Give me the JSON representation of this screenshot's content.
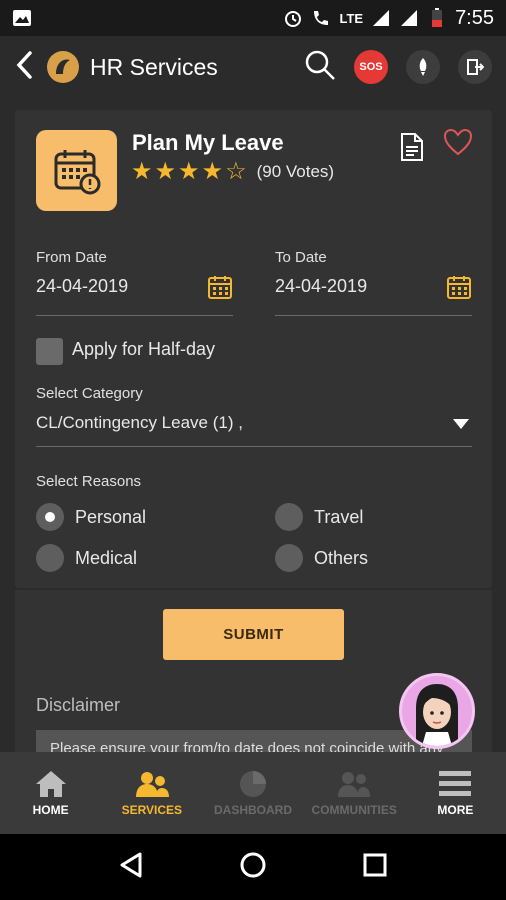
{
  "status_bar": {
    "time": "7:55",
    "network": "4G",
    "lte": "LTE"
  },
  "app_bar": {
    "title": "HR Services",
    "sos": "SOS"
  },
  "service": {
    "name": "Plan My Leave",
    "rating": 4,
    "rating_max": 5,
    "votes": "(90 Votes)"
  },
  "form": {
    "from_label": "From Date",
    "from_value": "24-04-2019",
    "to_label": "To Date",
    "to_value": "24-04-2019",
    "half_day_label": "Apply for Half-day",
    "half_day_checked": false,
    "category_label": "Select Category",
    "category_value": "CL/Contingency Leave (1) ,",
    "reasons_label": "Select Reasons",
    "reasons": [
      {
        "label": "Personal",
        "selected": true
      },
      {
        "label": "Travel",
        "selected": false
      },
      {
        "label": "Medical",
        "selected": false
      },
      {
        "label": "Others",
        "selected": false
      }
    ],
    "submit_label": "SUBMIT"
  },
  "disclaimer": {
    "title": "Disclaimer",
    "text": "Please ensure your from/to date does not coincide with any"
  },
  "bottom_nav": [
    {
      "label": "HOME",
      "icon": "home-icon",
      "state": "normal"
    },
    {
      "label": "SERVICES",
      "icon": "services-icon",
      "state": "active"
    },
    {
      "label": "DASHBOARD",
      "icon": "dashboard-icon",
      "state": "dim"
    },
    {
      "label": "COMMUNITIES",
      "icon": "communities-icon",
      "state": "dim"
    },
    {
      "label": "MORE",
      "icon": "menu-icon",
      "state": "normal"
    }
  ],
  "colors": {
    "accent": "#f7bd6a",
    "star": "#f5b82e",
    "sos": "#e53935",
    "heart": "#e05555"
  }
}
